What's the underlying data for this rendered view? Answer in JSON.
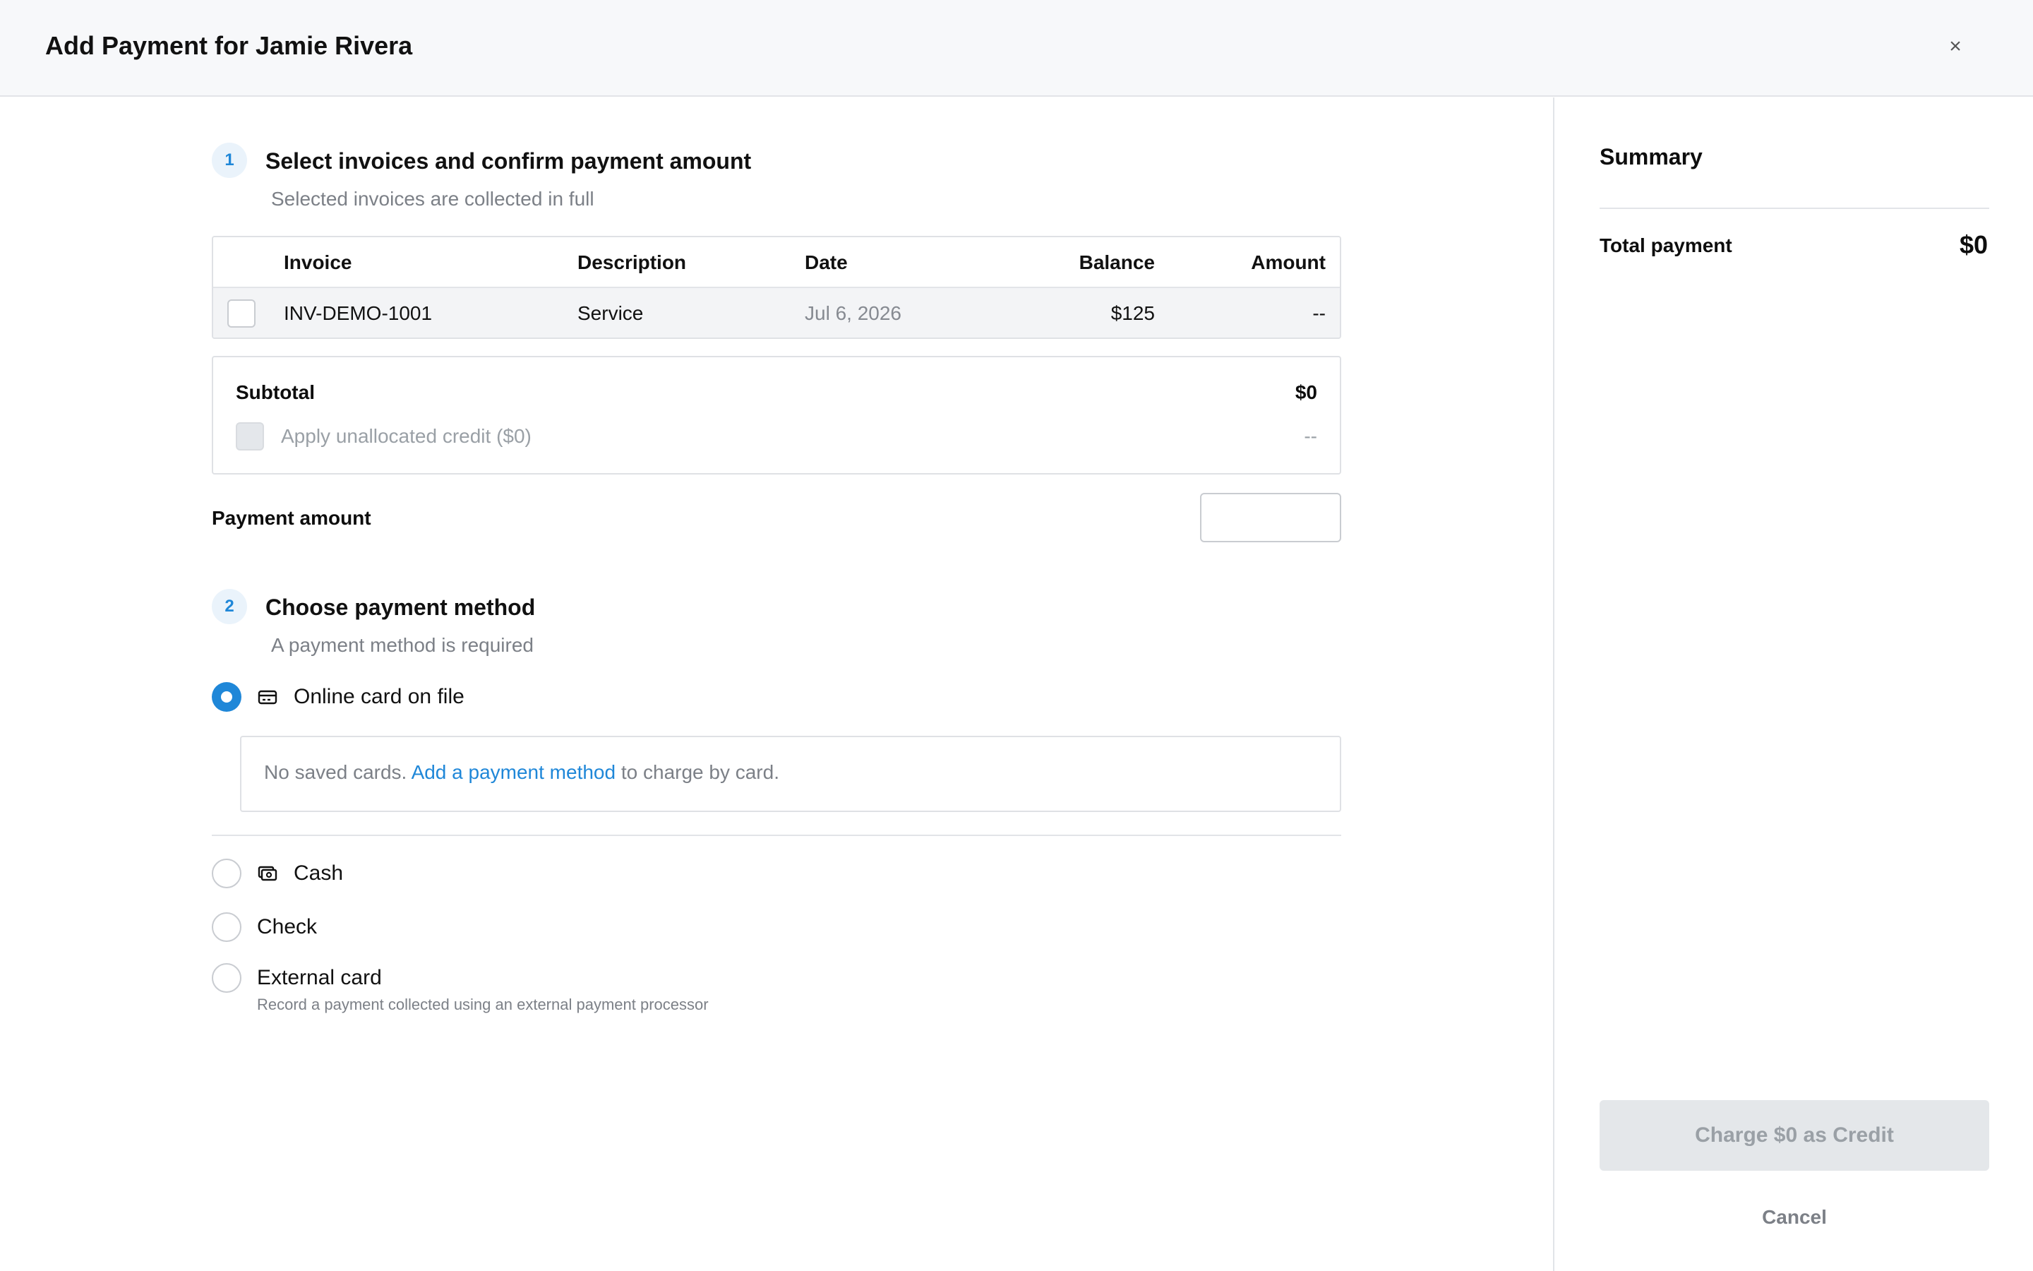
{
  "header": {
    "title": "Add Payment for Jamie Rivera",
    "close_symbol": "×"
  },
  "step1": {
    "number": "1",
    "title": "Select invoices and confirm payment amount",
    "subtitle": "Selected invoices are collected in full"
  },
  "invoice_table": {
    "columns": [
      "Invoice",
      "Description",
      "Date",
      "Balance",
      "Amount"
    ],
    "rows": [
      {
        "invoice": "INV-DEMO-1001",
        "description": "Service",
        "date": "Jul 6, 2026",
        "balance": "$125",
        "amount": "--",
        "selected": false
      }
    ]
  },
  "subtotal": {
    "label": "Subtotal",
    "value": "$0",
    "credit_label": "Apply unallocated credit ($0)",
    "credit_value": "--"
  },
  "payment_amount": {
    "label": "Payment amount",
    "value": ""
  },
  "step2": {
    "number": "2",
    "title": "Choose payment method",
    "subtitle": "A payment method is required"
  },
  "methods": {
    "online_card": {
      "label": "Online card on file",
      "icon": "credit-card-icon",
      "selected": true
    },
    "no_cards": {
      "prefix": "No saved cards.",
      "link": "Add a payment method",
      "suffix": "to charge by card."
    },
    "cash": {
      "label": "Cash",
      "icon": "cash-icon",
      "selected": false
    },
    "check": {
      "label": "Check",
      "selected": false
    },
    "external_card": {
      "label": "External card",
      "description": "Record a payment collected using an external payment processor",
      "selected": false
    }
  },
  "summary": {
    "title": "Summary",
    "total_label": "Total payment",
    "total_value": "$0",
    "charge_button": "Charge $0 as Credit",
    "cancel_button": "Cancel"
  },
  "colors": {
    "accent": "#1f87d8",
    "header_bg": "#f7f8fa",
    "disabled_button_bg": "#e4e7ea"
  }
}
